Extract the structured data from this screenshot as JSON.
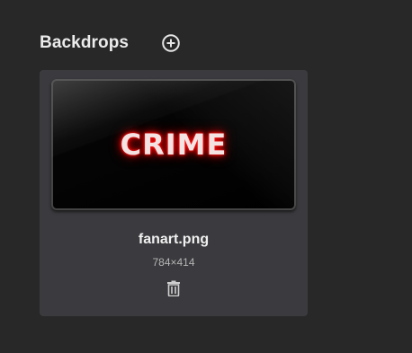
{
  "section": {
    "title": "Backdrops",
    "add_icon": "plus-circle-icon"
  },
  "backdrops": [
    {
      "thumbnail_text": "CRIME",
      "file_name": "fanart.png",
      "dimensions": "784×414",
      "delete_icon": "trash-icon"
    }
  ],
  "colors": {
    "background": "#282828",
    "card": "#3b3b3f",
    "accent_glow": "#ff1010"
  }
}
